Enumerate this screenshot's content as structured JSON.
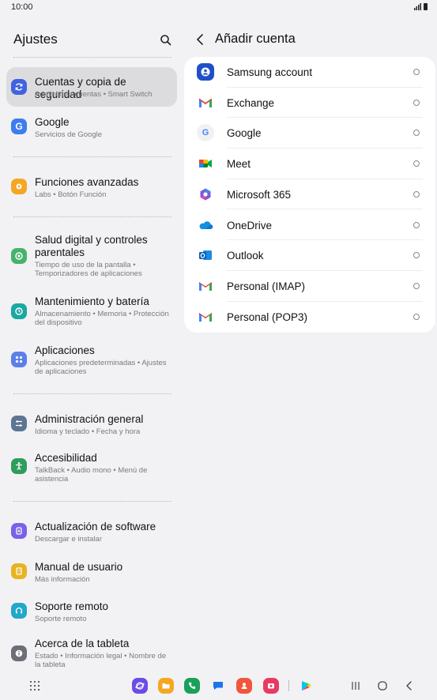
{
  "status_bar": {
    "time": "10:00"
  },
  "settings": {
    "title": "Ajustes",
    "items": [
      {
        "title": "Cuentas y copia de seguridad",
        "subtitle": "Administrar cuentas  •  Smart Switch",
        "icon": "sync-icon",
        "color": "#3f63e0"
      },
      {
        "title": "Google",
        "subtitle": "Servicios de Google",
        "icon": "google-g-icon",
        "color": "#3c7df0"
      },
      {
        "title": "Funciones avanzadas",
        "subtitle": "Labs  •  Botón Función",
        "icon": "gear-plus-icon",
        "color": "#f5a623"
      },
      {
        "title": "Salud digital y controles parentales",
        "subtitle": "Tiempo de uso de la pantalla  •  Temporizadores de aplicaciones",
        "icon": "wellbeing-icon",
        "color": "#46b36b"
      },
      {
        "title": "Mantenimiento y batería",
        "subtitle": "Almacenamiento  •  Memoria  •  Protección del dispositivo",
        "icon": "maintenance-icon",
        "color": "#1aa9a0"
      },
      {
        "title": "Aplicaciones",
        "subtitle": "Aplicaciones predeterminadas  •  Ajustes de aplicaciones",
        "icon": "apps-grid-icon",
        "color": "#5c7fe8"
      },
      {
        "title": "Administración general",
        "subtitle": "Idioma y teclado  •  Fecha y hora",
        "icon": "sliders-icon",
        "color": "#5d7594"
      },
      {
        "title": "Accesibilidad",
        "subtitle": "TalkBack  •  Audio mono  •  Menú de asistencia",
        "icon": "accessibility-icon",
        "color": "#2f9d5c"
      },
      {
        "title": "Actualización de software",
        "subtitle": "Descargar e instalar",
        "icon": "software-update-icon",
        "color": "#7b61e8"
      },
      {
        "title": "Manual de usuario",
        "subtitle": "Más información",
        "icon": "manual-icon",
        "color": "#e6b421"
      },
      {
        "title": "Soporte remoto",
        "subtitle": "Soporte remoto",
        "icon": "headset-icon",
        "color": "#22a8c9"
      },
      {
        "title": "Acerca de la tableta",
        "subtitle": "Estado  •  Información legal  •  Nombre de la tableta",
        "icon": "info-icon",
        "color": "#6c6f75"
      }
    ]
  },
  "add_account": {
    "title": "Añadir cuenta",
    "accounts": [
      {
        "name": "Samsung account",
        "icon": "samsung-account-icon"
      },
      {
        "name": "Exchange",
        "icon": "gmail-icon"
      },
      {
        "name": "Google",
        "icon": "google-icon"
      },
      {
        "name": "Meet",
        "icon": "meet-icon"
      },
      {
        "name": "Microsoft 365",
        "icon": "microsoft365-icon"
      },
      {
        "name": "OneDrive",
        "icon": "onedrive-icon"
      },
      {
        "name": "Outlook",
        "icon": "outlook-icon"
      },
      {
        "name": "Personal (IMAP)",
        "icon": "gmail-icon"
      },
      {
        "name": "Personal (POP3)",
        "icon": "gmail-icon"
      }
    ]
  },
  "navbar": {
    "apps": [
      "app-drawer-icon",
      "internet-icon",
      "my-files-icon",
      "phone-icon",
      "messages-icon",
      "contacts-icon",
      "screen-recorder-icon",
      "play-store-icon"
    ],
    "buttons": [
      "recents-icon",
      "home-icon",
      "back-icon"
    ]
  }
}
